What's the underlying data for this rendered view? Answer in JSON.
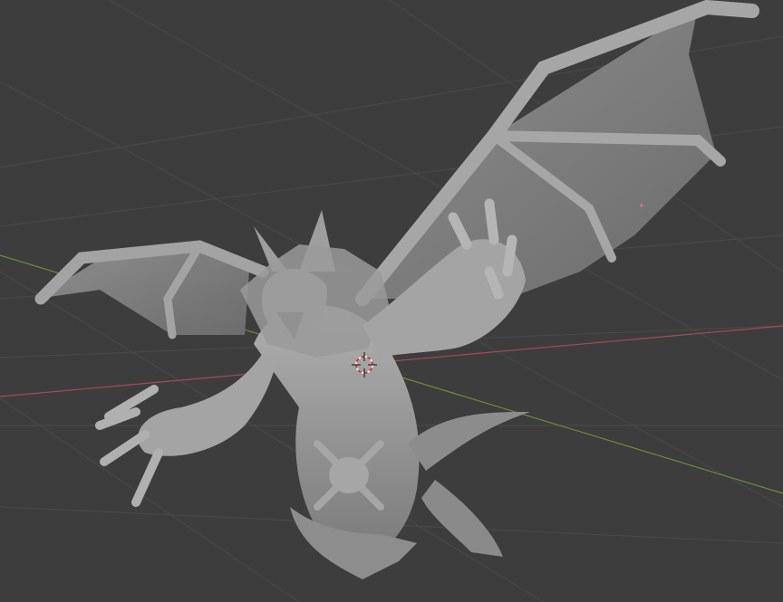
{
  "viewport": {
    "background": "#3d3d3d",
    "grid_color": "#4a4a4a",
    "x_axis_color": "#a84a55",
    "y_axis_color": "#6b8c3a",
    "model_color": "#8f8f8f",
    "model_shade": "#6e6e6e",
    "model_highlight": "#b5b5b5",
    "cursor_color_a": "#e8e8e8",
    "cursor_color_b": "#d03a3a"
  },
  "model": {
    "name": "winged-dragon-sculpt",
    "shading": "solid-matcap"
  },
  "icons": {
    "cursor": "3d-cursor-icon",
    "origin": "object-origin-icon"
  }
}
